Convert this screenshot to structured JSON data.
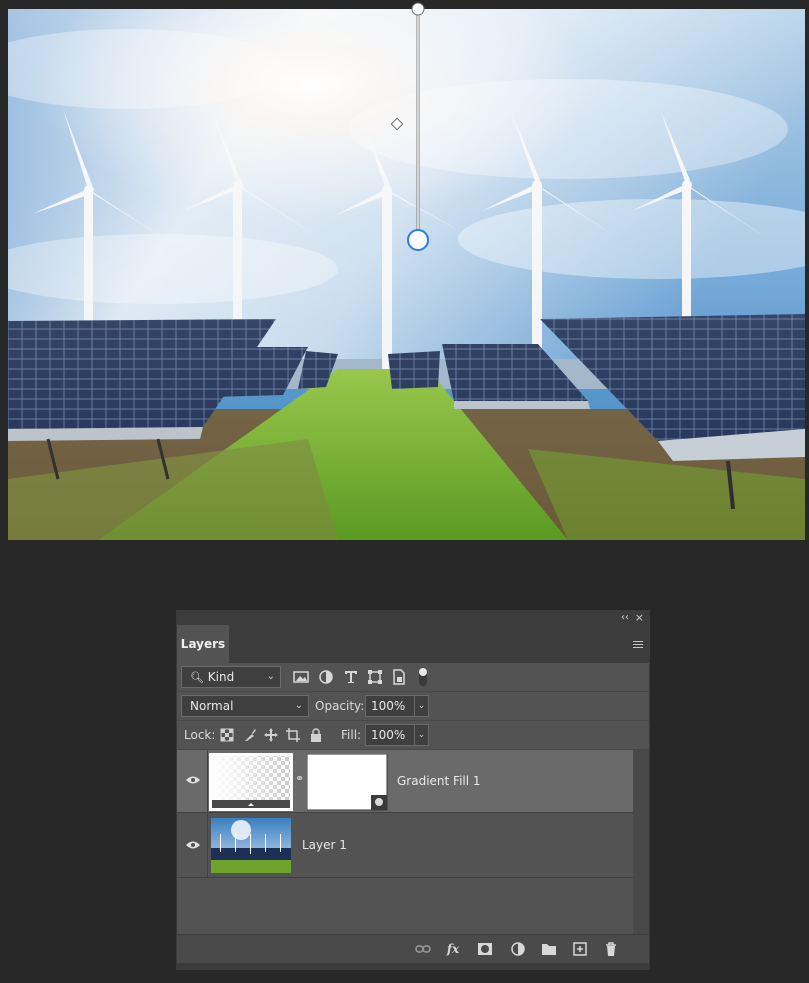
{
  "panel": {
    "tab_label": "Layers",
    "filter_select": "Kind",
    "blend_mode": "Normal",
    "opacity_label": "Opacity:",
    "opacity_value": "100%",
    "lock_label": "Lock:",
    "fill_label": "Fill:",
    "fill_value": "100%"
  },
  "layers": [
    {
      "name": "Gradient Fill 1",
      "selected": true,
      "visible": true
    },
    {
      "name": "Layer 1",
      "selected": false,
      "visible": true
    }
  ],
  "icons": {
    "filter": [
      "image-filter-icon",
      "adjustment-filter-icon",
      "type-filter-icon",
      "shape-filter-icon",
      "smart-object-filter-icon"
    ],
    "lock": [
      "lock-transparent-pixels-icon",
      "lock-image-pixels-icon",
      "lock-position-icon",
      "lock-artboard-icon",
      "lock-all-icon"
    ],
    "bottom": [
      "link-layers-icon",
      "fx-icon",
      "add-mask-icon",
      "adjustment-layer-icon",
      "group-folder-icon",
      "new-layer-icon",
      "trash-icon"
    ]
  },
  "colors": {
    "panel_bg": "#535353",
    "selected_layer": "#6a6a6a",
    "app_bg": "#282828"
  }
}
